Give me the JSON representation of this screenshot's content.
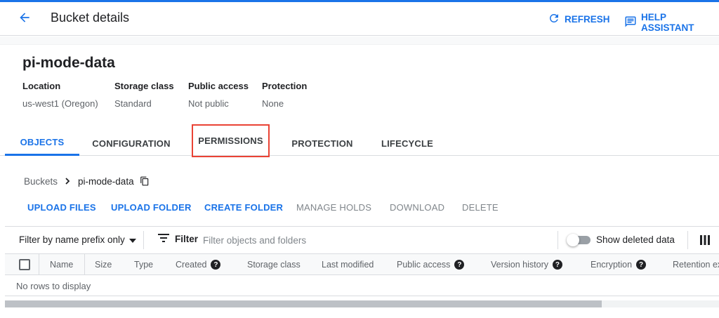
{
  "header": {
    "title": "Bucket details",
    "back_icon": "arrow-back-icon",
    "refresh_label": "REFRESH",
    "help_label": "HELP ASSISTANT",
    "accent_color": "#1a73e8"
  },
  "bucket": {
    "name": "pi-mode-data",
    "properties": [
      {
        "label": "Location",
        "value": "us-west1 (Oregon)"
      },
      {
        "label": "Storage class",
        "value": "Standard"
      },
      {
        "label": "Public access",
        "value": "Not public"
      },
      {
        "label": "Protection",
        "value": "None"
      }
    ]
  },
  "tabs": [
    {
      "label": "OBJECTS",
      "active": true
    },
    {
      "label": "CONFIGURATION",
      "active": false
    },
    {
      "label": "PERMISSIONS",
      "active": false,
      "highlighted": true,
      "highlight_color": "#ea4335"
    },
    {
      "label": "PROTECTION",
      "active": false
    },
    {
      "label": "LIFECYCLE",
      "active": false
    }
  ],
  "breadcrumb": {
    "root": "Buckets",
    "separator": ">",
    "current": "pi-mode-data"
  },
  "actions": [
    {
      "label": "UPLOAD FILES",
      "enabled": true
    },
    {
      "label": "UPLOAD FOLDER",
      "enabled": true
    },
    {
      "label": "CREATE FOLDER",
      "enabled": true
    },
    {
      "label": "MANAGE HOLDS",
      "enabled": false
    },
    {
      "label": "DOWNLOAD",
      "enabled": false
    },
    {
      "label": "DELETE",
      "enabled": false
    }
  ],
  "filter": {
    "prefix_dropdown": "Filter by name prefix only",
    "filter_label": "Filter",
    "placeholder": "Filter objects and folders",
    "show_deleted_label": "Show deleted data",
    "show_deleted_on": false
  },
  "table": {
    "columns": [
      {
        "label": "Name",
        "help": false
      },
      {
        "label": "Size",
        "help": false
      },
      {
        "label": "Type",
        "help": false
      },
      {
        "label": "Created",
        "help": true
      },
      {
        "label": "Storage class",
        "help": false
      },
      {
        "label": "Last modified",
        "help": false
      },
      {
        "label": "Public access",
        "help": true
      },
      {
        "label": "Version history",
        "help": true
      },
      {
        "label": "Encryption",
        "help": true
      },
      {
        "label": "Retention ex",
        "help": false
      }
    ],
    "empty_message": "No rows to display"
  }
}
